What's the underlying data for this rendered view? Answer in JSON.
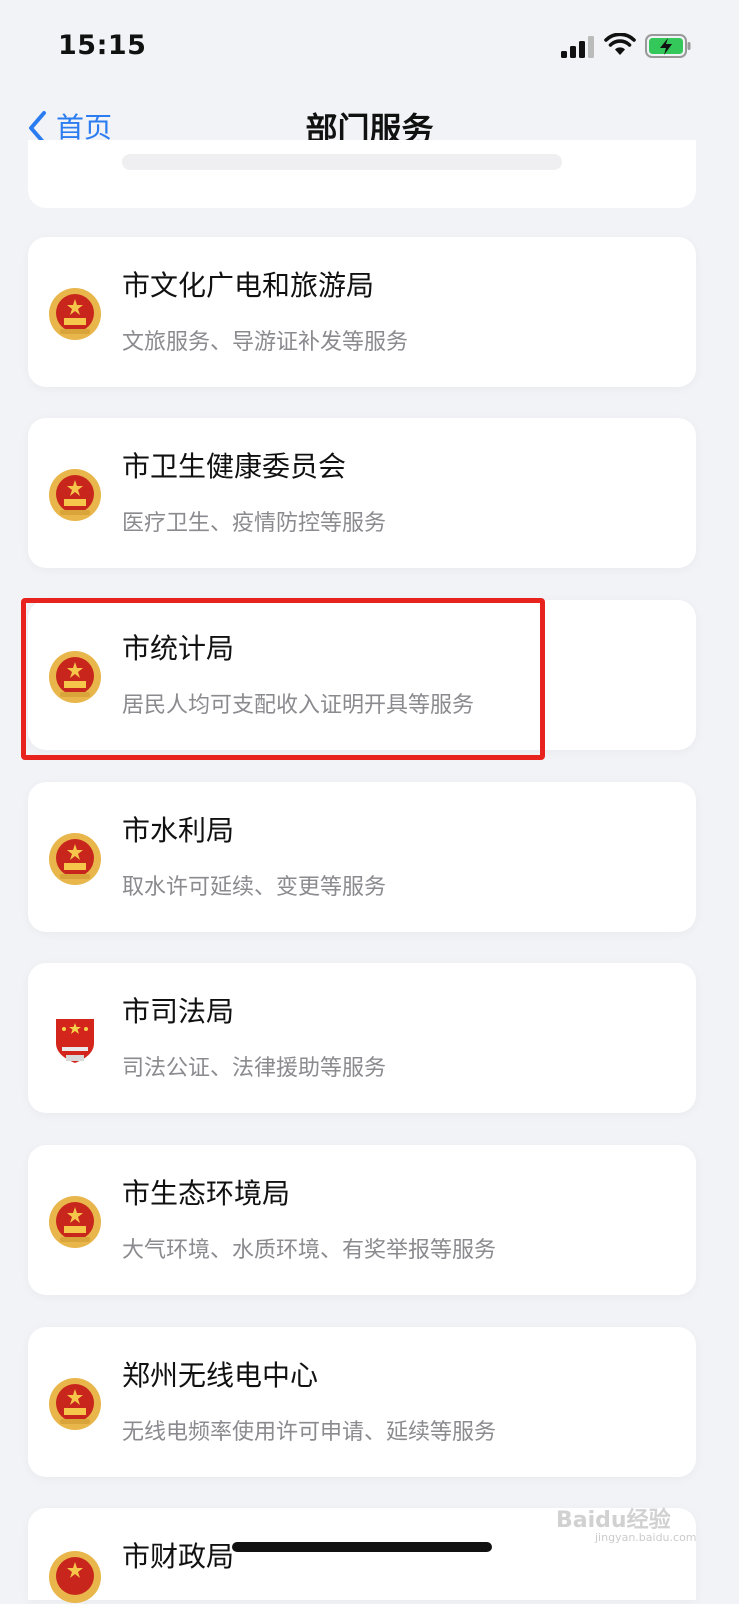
{
  "status_bar": {
    "time": "15:15",
    "signal_icon": "cellular-signal-icon",
    "wifi_icon": "wifi-icon",
    "battery_icon": "battery-charging-icon",
    "battery_color": "#34c759"
  },
  "nav": {
    "back_label": "首页",
    "title": "部门服务",
    "accent": "#2b7cf0"
  },
  "departments": [
    {
      "name": "市文化广电和旅游局",
      "desc": "文旅服务、导游证补发等服务",
      "emblem": "national-emblem-icon"
    },
    {
      "name": "市卫生健康委员会",
      "desc": "医疗卫生、疫情防控等服务",
      "emblem": "national-emblem-icon"
    },
    {
      "name": "市统计局",
      "desc": "居民人均可支配收入证明开具等服务",
      "emblem": "national-emblem-icon",
      "highlighted": true
    },
    {
      "name": "市水利局",
      "desc": "取水许可延续、变更等服务",
      "emblem": "national-emblem-icon"
    },
    {
      "name": "市司法局",
      "desc": "司法公证、法律援助等服务",
      "emblem": "justice-emblem-icon"
    },
    {
      "name": "市生态环境局",
      "desc": "大气环境、水质环境、有奖举报等服务",
      "emblem": "national-emblem-icon"
    },
    {
      "name": "郑州无线电中心",
      "desc": "无线电频率使用许可申请、延续等服务",
      "emblem": "national-emblem-icon"
    },
    {
      "name": "市财政局",
      "desc": "",
      "emblem": "national-emblem-icon"
    }
  ],
  "highlight_color": "#e8231e",
  "watermark": {
    "text": "Baidu经验",
    "sub": "jingyan.baidu.com"
  }
}
